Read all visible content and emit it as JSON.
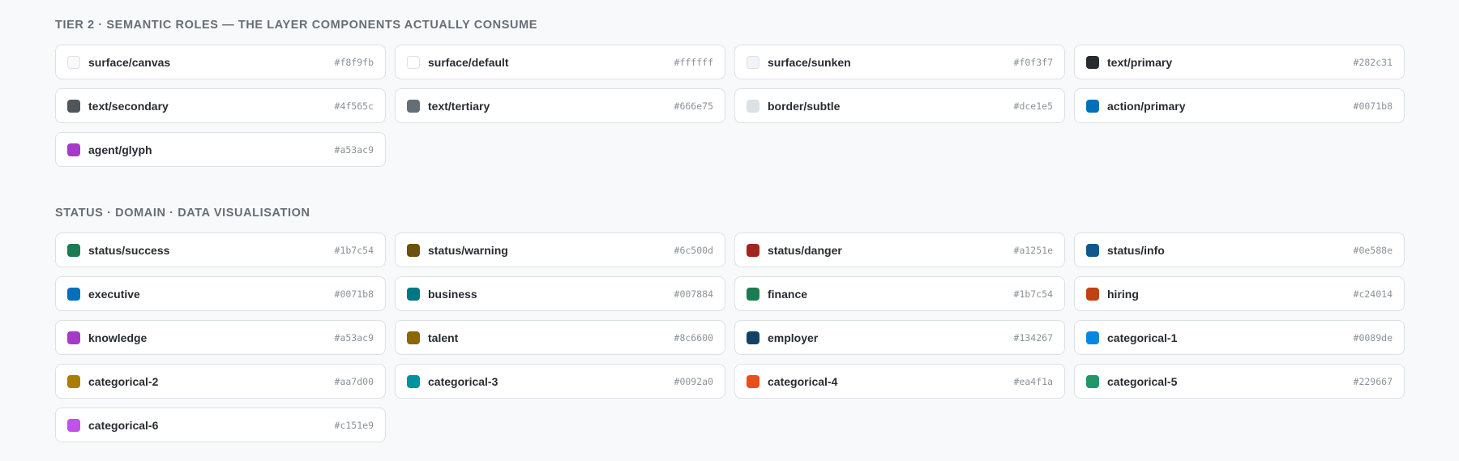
{
  "tier2": {
    "title": "TIER 2 · SEMANTIC ROLES — THE LAYER COMPONENTS ACTUALLY CONSUME",
    "tokens": [
      {
        "name": "surface/canvas",
        "hex": "#f8f9fb"
      },
      {
        "name": "surface/default",
        "hex": "#ffffff"
      },
      {
        "name": "surface/sunken",
        "hex": "#f0f3f7"
      },
      {
        "name": "text/primary",
        "hex": "#282c31"
      },
      {
        "name": "text/secondary",
        "hex": "#4f565c"
      },
      {
        "name": "text/tertiary",
        "hex": "#666e75"
      },
      {
        "name": "border/subtle",
        "hex": "#dce1e5"
      },
      {
        "name": "action/primary",
        "hex": "#0071b8"
      },
      {
        "name": "agent/glyph",
        "hex": "#a53ac9"
      }
    ]
  },
  "status_domain": {
    "title": "STATUS · DOMAIN · DATA VISUALISATION",
    "tokens": [
      {
        "name": "status/success",
        "hex": "#1b7c54"
      },
      {
        "name": "status/warning",
        "hex": "#6c500d"
      },
      {
        "name": "status/danger",
        "hex": "#a1251e"
      },
      {
        "name": "status/info",
        "hex": "#0e588e"
      },
      {
        "name": "executive",
        "hex": "#0071b8"
      },
      {
        "name": "business",
        "hex": "#007884"
      },
      {
        "name": "finance",
        "hex": "#1b7c54"
      },
      {
        "name": "hiring",
        "hex": "#c24014"
      },
      {
        "name": "knowledge",
        "hex": "#a53ac9"
      },
      {
        "name": "talent",
        "hex": "#8c6600"
      },
      {
        "name": "employer",
        "hex": "#134267"
      },
      {
        "name": "categorical-1",
        "hex": "#0089de"
      },
      {
        "name": "categorical-2",
        "hex": "#aa7d00"
      },
      {
        "name": "categorical-3",
        "hex": "#0092a0"
      },
      {
        "name": "categorical-4",
        "hex": "#ea4f1a"
      },
      {
        "name": "categorical-5",
        "hex": "#229667"
      },
      {
        "name": "categorical-6",
        "hex": "#c151e9"
      }
    ]
  }
}
